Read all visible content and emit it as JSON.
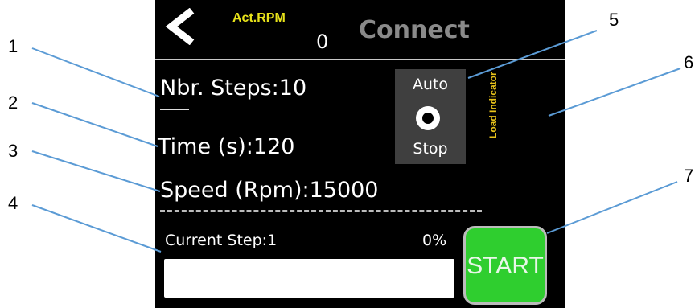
{
  "callouts": [
    "1",
    "2",
    "3",
    "4",
    "5",
    "6",
    "7"
  ],
  "header": {
    "rpm_label": "Act.RPM",
    "rpm_value": "0",
    "connect_label": "Connect"
  },
  "settings": {
    "steps_label": "Nbr. Steps:",
    "steps_value": "10",
    "time_label": "Time (s):",
    "time_value": "120",
    "speed_label": "Speed (Rpm):",
    "speed_value": "15000"
  },
  "auto_stop": {
    "top_label": "Auto",
    "bottom_label": "Stop",
    "selected": true
  },
  "load_indicator": "Load Indicator",
  "progress": {
    "step_label": "Current Step:",
    "step_value": "1",
    "percent_text": "0%",
    "fraction": 0
  },
  "start_label": "START",
  "colors": {
    "panel_bg": "#000000",
    "accent_yellow": "#e7e21a",
    "start_green": "#2fce2f",
    "callout_line": "#5b9bd5"
  },
  "icons": {
    "back": "chevron-left-icon"
  }
}
